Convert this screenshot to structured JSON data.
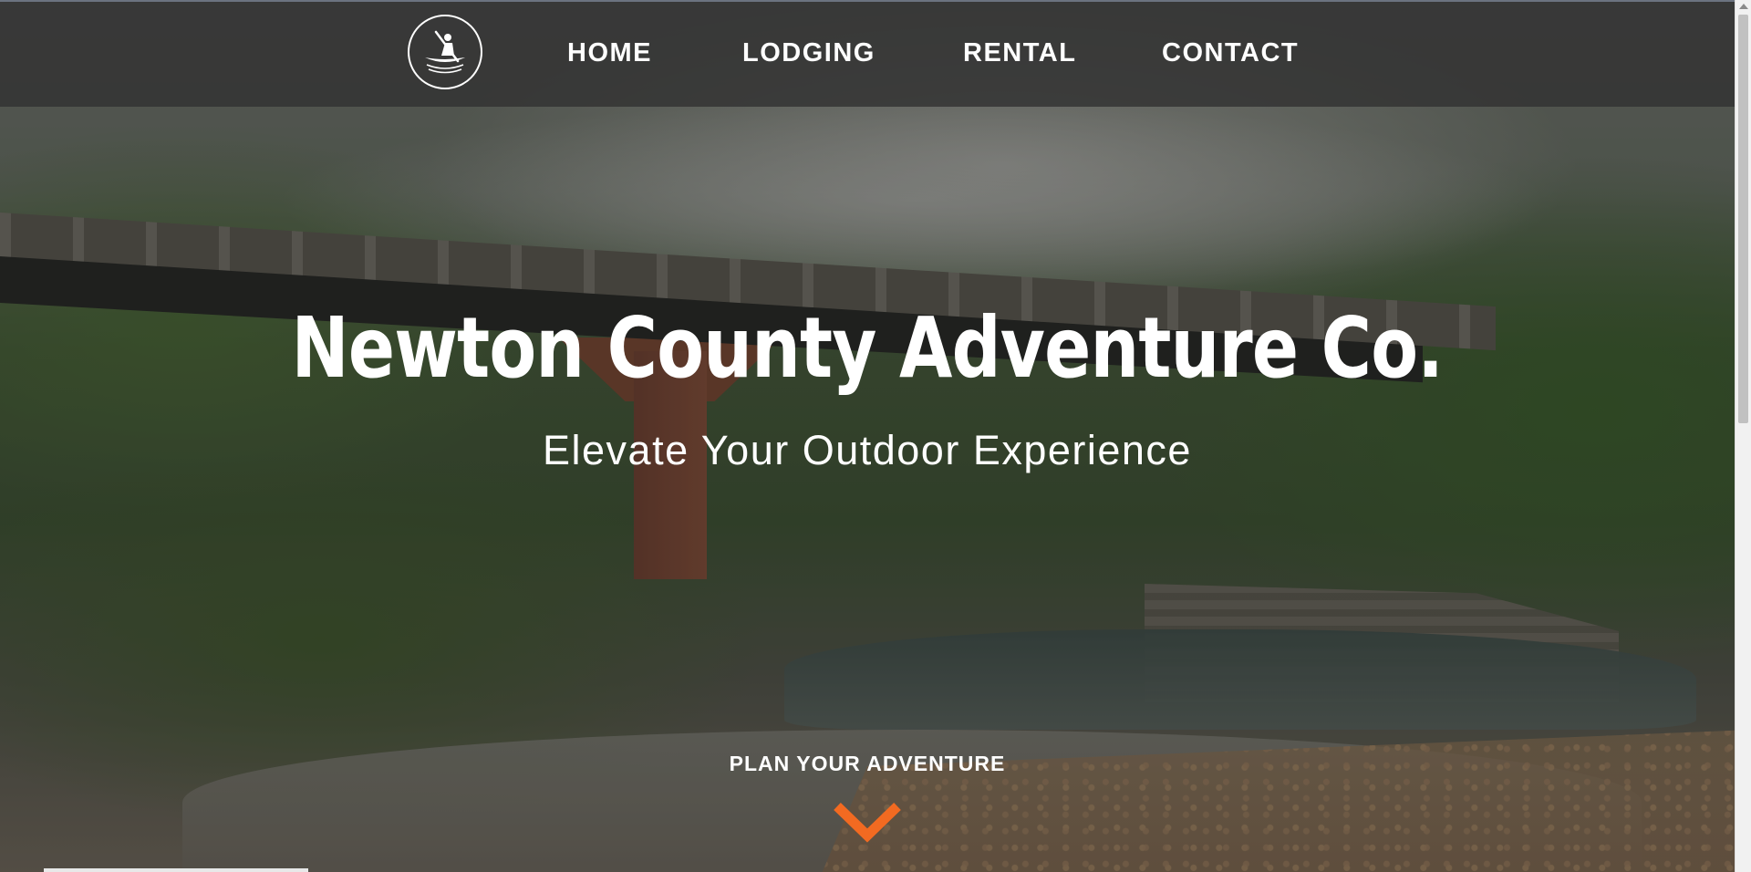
{
  "header": {
    "logo_icon": "kayak-logo-icon",
    "nav": [
      {
        "label": "HOME"
      },
      {
        "label": "LODGING"
      },
      {
        "label": "RENTAL"
      },
      {
        "label": "CONTACT"
      }
    ]
  },
  "hero": {
    "title": "Newton County Adventure Co.",
    "subtitle": "Elevate Your Outdoor Experience",
    "cta_label": "PLAN YOUR ADVENTURE",
    "cta_icon": "chevron-down-icon",
    "accent_color": "#f26a21"
  },
  "colors": {
    "header_bg": "#323232",
    "text": "#ffffff",
    "accent": "#f26a21"
  }
}
